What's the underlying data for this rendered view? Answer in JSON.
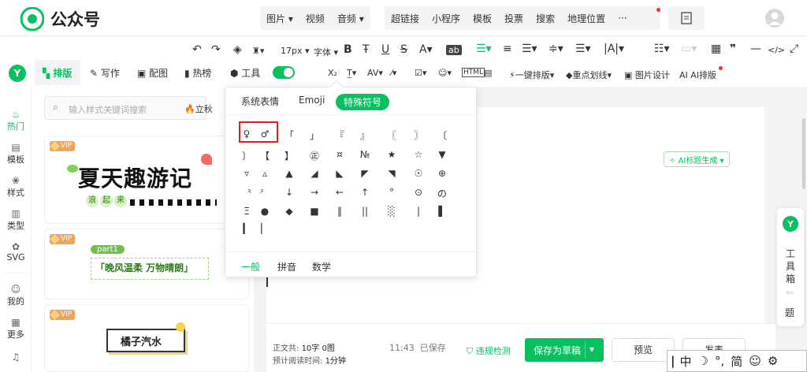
{
  "app": {
    "title": "公众号"
  },
  "topnav": {
    "group1": [
      "图片",
      "视频",
      "音频"
    ],
    "group2": [
      "超链接",
      "小程序",
      "模板",
      "投票",
      "搜索",
      "地理位置",
      "···"
    ]
  },
  "toolbar": {
    "font_size": "17px",
    "font": "字体",
    "tabs": [
      "排版",
      "写作",
      "配图",
      "热榜",
      "工具"
    ],
    "actions": [
      "一键排版",
      "重点划线",
      "图片设计",
      "AI排版"
    ]
  },
  "leftnav": [
    {
      "icon": "flame-icon",
      "label": "热门"
    },
    {
      "icon": "template-icon",
      "label": "模板"
    },
    {
      "icon": "style-icon",
      "label": "样式"
    },
    {
      "icon": "type-icon",
      "label": "类型"
    },
    {
      "icon": "svg-icon",
      "label": "SVG"
    },
    {
      "icon": "user-icon",
      "label": "我的"
    },
    {
      "icon": "more-icon",
      "label": "更多"
    }
  ],
  "stylepanel": {
    "search_placeholder": "输入样式关键词搜索",
    "hot_label": "立秋",
    "vip": "VIP",
    "card1": {
      "title": "夏天趣游记",
      "sub": [
        "浪",
        "起",
        "来"
      ]
    },
    "card2": {
      "tag": "part1",
      "title": "「晚风温柔 万物晴朗」"
    },
    "card3": {
      "title": "橘子汽水"
    }
  },
  "popup": {
    "tabs": [
      "系统表情",
      "Emoji",
      "特殊符号"
    ],
    "footer_tabs": [
      "一般",
      "拼音",
      "数学"
    ],
    "symbols": [
      [
        "♀",
        "♂",
        "「",
        "」",
        "『",
        "』",
        "〖",
        "〗",
        "〔"
      ],
      [
        "〕",
        "【",
        "】",
        "㊣",
        "¤",
        "№",
        "★",
        "☆",
        "▼"
      ],
      [
        "▿",
        "▵",
        "▲",
        "◢",
        "◣",
        "◤",
        "◥",
        "☉",
        "⊕"
      ],
      [
        "〝",
        "〞",
        "↓",
        "→",
        "←",
        "↑",
        "°",
        "⊙",
        "の"
      ],
      [
        "Ξ",
        "●",
        "◆",
        "■",
        "‖",
        "||",
        "░",
        "|",
        "▌"
      ],
      [
        "▎",
        "▏"
      ]
    ]
  },
  "editor": {
    "ai_title": "AI标题生成",
    "stats": {
      "label": "正文共:",
      "chars": "10字 0图",
      "read_label": "预计阅读时间:",
      "read_time": "1分钟"
    },
    "saved": "11:43  已保存",
    "check": "违规检测",
    "save_draft": "保存为草稿",
    "preview": "预览",
    "publish": "发表"
  },
  "sidewidget": {
    "label": [
      "工",
      "具",
      "箱"
    ],
    "extra": "题"
  },
  "ime": [
    "中",
    "☽",
    "°,",
    "简",
    "☺",
    "⚙"
  ],
  "colors": {
    "brand": "#07c160",
    "highlight": "#e02020"
  }
}
